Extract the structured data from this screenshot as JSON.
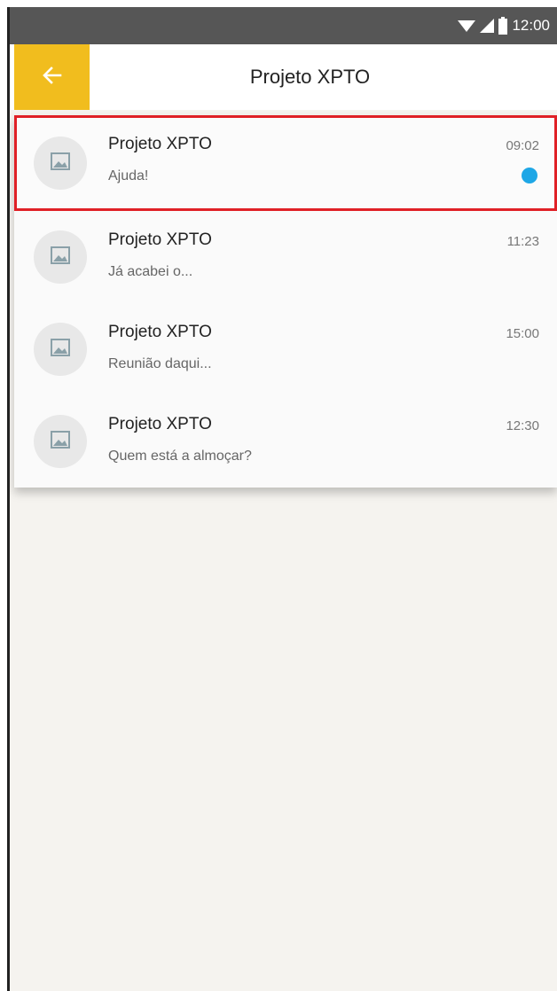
{
  "status_bar": {
    "time": "12:00",
    "icons": [
      "wifi-icon",
      "signal-icon",
      "battery-icon"
    ]
  },
  "app_bar": {
    "back_icon": "arrow-left-icon",
    "title": "Projeto XPTO",
    "accent_color": "#f1bd1e"
  },
  "chats": [
    {
      "name": "Projeto XPTO",
      "preview": "Ajuda!",
      "time": "09:02",
      "unread": true,
      "selected": true
    },
    {
      "name": "Projeto XPTO",
      "preview": "Já acabei o...",
      "time": "11:23",
      "unread": false,
      "selected": false
    },
    {
      "name": "Projeto XPTO",
      "preview": "Reunião daqui...",
      "time": "15:00",
      "unread": false,
      "selected": false
    },
    {
      "name": "Projeto XPTO",
      "preview": "Quem está a almoçar?",
      "time": "12:30",
      "unread": false,
      "selected": false
    }
  ],
  "colors": {
    "unread_dot": "#1ea7e6",
    "selection_border": "#e02026",
    "status_bar": "#565656"
  }
}
